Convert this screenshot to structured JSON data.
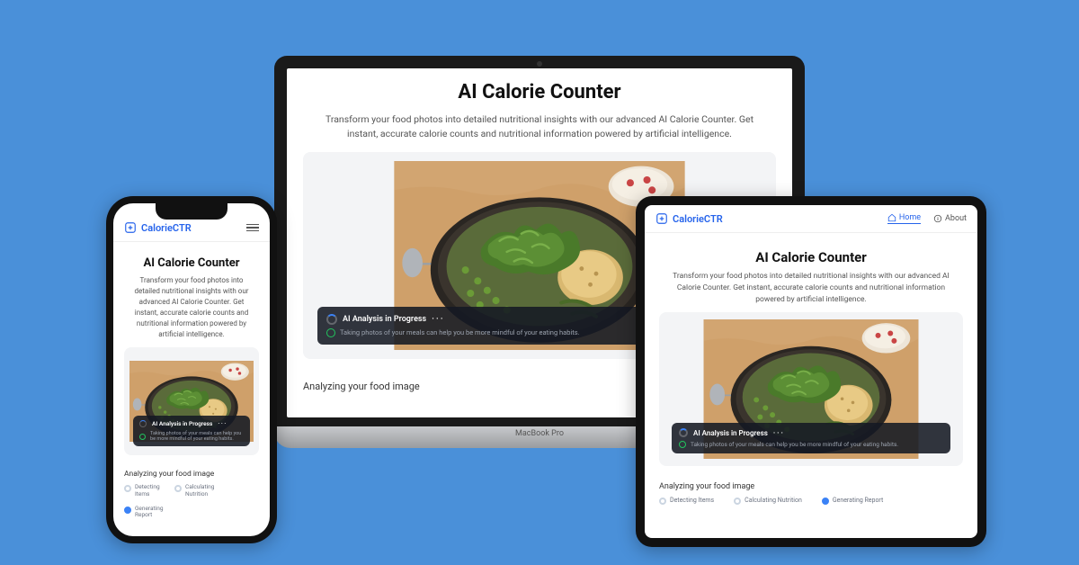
{
  "brand": {
    "name": "CalorieCTR"
  },
  "nav": {
    "home": "Home",
    "about": "About"
  },
  "hero": {
    "title": "AI Calorie Counter",
    "description": "Transform your food photos into detailed nutritional insights with our advanced AI Calorie Counter. Get instant, accurate calorie counts and nutritional information powered by artificial intelligence."
  },
  "overlay": {
    "title": "AI Analysis in Progress",
    "dots": "· · ·",
    "tip": "Taking photos of your meals can help you be more mindful of your eating habits."
  },
  "status": {
    "label": "Analyzing your food image",
    "steps": [
      "Detecting Items",
      "Calculating Nutrition",
      "Generating Report"
    ]
  },
  "laptop_label": "MacBook Pro"
}
